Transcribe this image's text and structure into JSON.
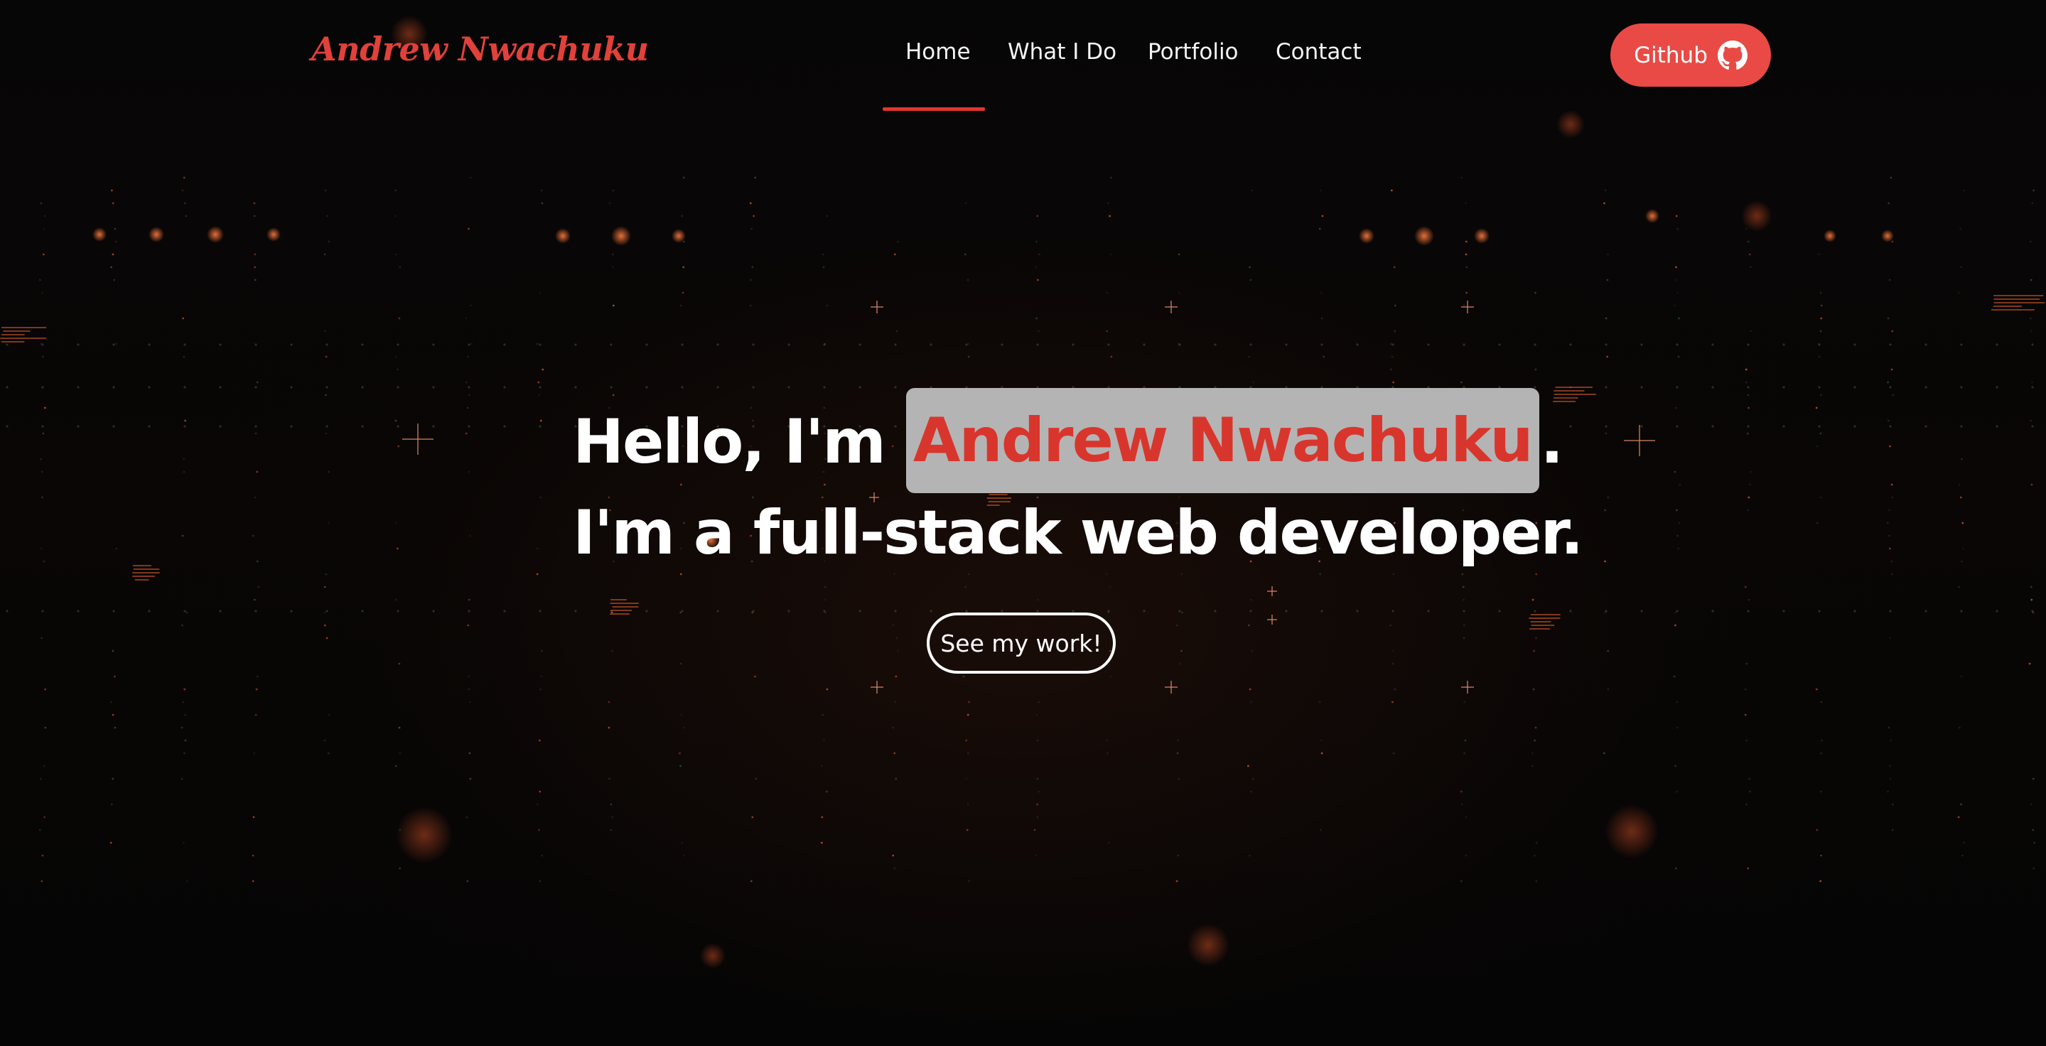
{
  "brand": {
    "name": "Andrew Nwachuku",
    "color": "#e0413a"
  },
  "nav": {
    "items": [
      {
        "label": "Home",
        "active": true
      },
      {
        "label": "What I Do",
        "active": false
      },
      {
        "label": "Portfolio",
        "active": false
      },
      {
        "label": "Contact",
        "active": false
      }
    ],
    "active_indicator_color": "#e2352d"
  },
  "github_button": {
    "label": "Github",
    "icon": "github-icon",
    "color": "#e94a45"
  },
  "hero": {
    "line1_prefix": "Hello, I'm ",
    "line1_name": "Andrew Nwachuku",
    "line1_suffix": ".",
    "line2": "I'm a full-stack web developer.",
    "name_color": "#d8362d",
    "name_highlight_bg": "#b4b4b4"
  },
  "cta": {
    "label": "See my work!"
  },
  "background": {
    "base_color": "#050505",
    "accent_color": "#e2602f"
  }
}
